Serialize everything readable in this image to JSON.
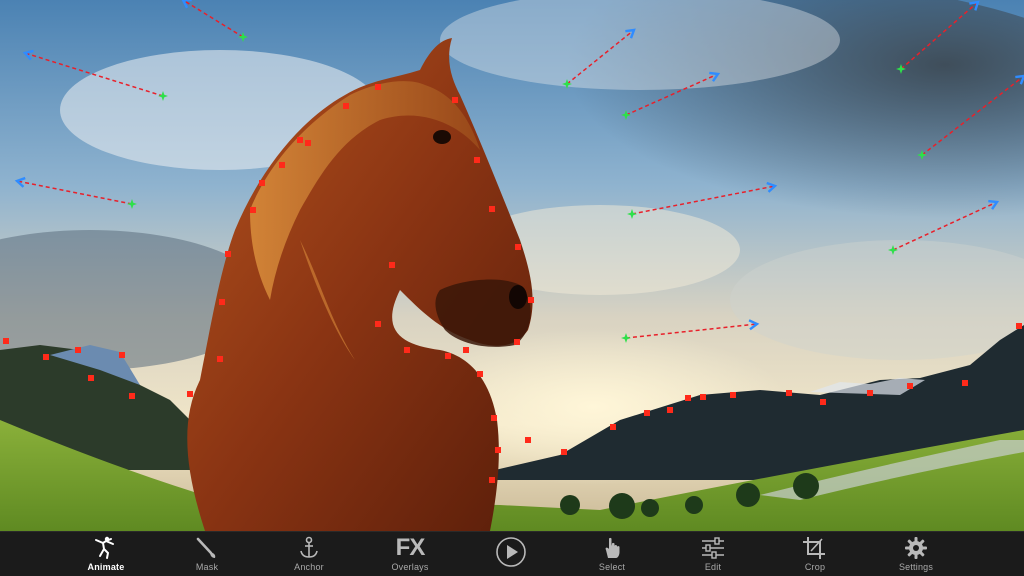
{
  "toolbar": {
    "items": [
      {
        "label": "Animate",
        "icon": "animate-icon",
        "active": true
      },
      {
        "label": "Mask",
        "icon": "brush-icon"
      },
      {
        "label": "Anchor",
        "icon": "anchor-icon"
      },
      {
        "label": "Overlays",
        "icon": "fx-icon",
        "glyph": "FX"
      },
      {
        "label": "",
        "icon": "play-icon"
      },
      {
        "label": "Select",
        "icon": "hand-icon"
      },
      {
        "label": "Edit",
        "icon": "sliders-icon"
      },
      {
        "label": "Crop",
        "icon": "crop-icon"
      },
      {
        "label": "Settings",
        "icon": "gear-icon"
      }
    ]
  },
  "colors": {
    "anchor_point": "#ff2a1a",
    "motion_path": "#e8202a",
    "motion_start": "#2ee04a",
    "motion_end": "#2f8cff",
    "toolbar_bg": "#1b1b1b",
    "label_inactive": "#a9a9a9",
    "label_active": "#ffffff"
  }
}
